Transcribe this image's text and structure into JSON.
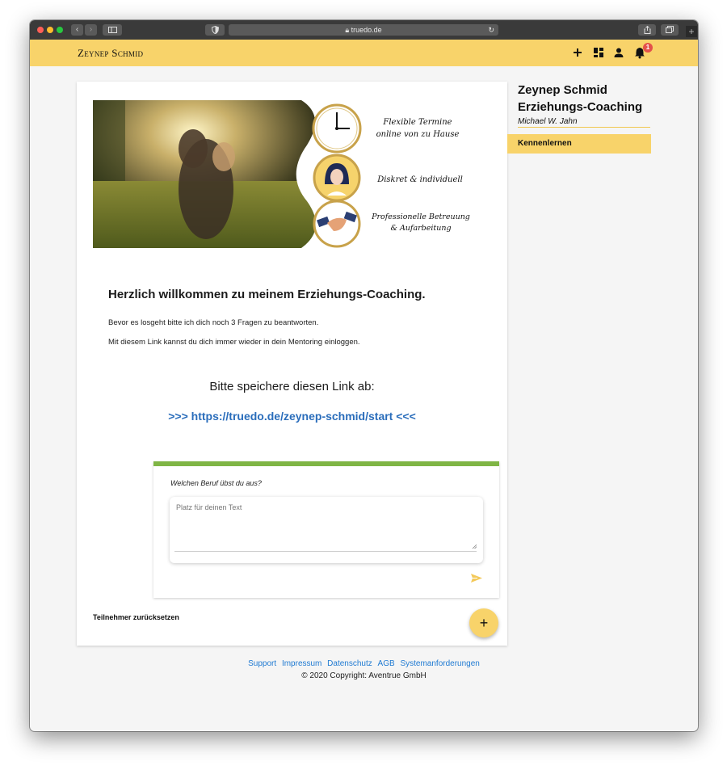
{
  "browser": {
    "url": "truedo.de"
  },
  "appbar": {
    "brand": "Zeynep Schmid",
    "notification_count": "1"
  },
  "main": {
    "banner_features": [
      {
        "line1": "Flexible Termine",
        "line2": "online von zu Hause"
      },
      {
        "line1": "Diskret & individuell",
        "line2": ""
      },
      {
        "line1": "Professionelle Betreuung",
        "line2": "& Aufarbeitung"
      }
    ],
    "welcome": "Herzlich willkommen zu meinem Erziehungs-Coaching.",
    "para1": "Bevor es losgeht bitte ich dich noch 3 Fragen zu beantworten.",
    "para2": "Mit diesem Link kannst du dich immer wieder in dein Mentoring einloggen.",
    "save_prompt": "Bitte speichere diesen Link ab:",
    "link_text": ">>> https://truedo.de/zeynep-schmid/start <<<",
    "question": {
      "label": "Welchen Beruf übst du aus?",
      "placeholder": "Platz für deinen Text"
    },
    "reset_label": "Teilnehmer zurücksetzen",
    "fab_label": "+"
  },
  "sidebar": {
    "title_line1": "Zeynep Schmid",
    "title_line2": "Erziehungs-Coaching",
    "author": "Michael W. Jahn",
    "items": [
      {
        "label": "Kennenlernen"
      }
    ]
  },
  "footer": {
    "links": [
      "Support",
      "Impressum",
      "Datenschutz",
      "AGB",
      "Systemanforderungen"
    ],
    "copyright": "© 2020 Copyright: Aventrue GmbH"
  },
  "colors": {
    "accent_yellow": "#f8d36a",
    "question_bar_green": "#7fb545",
    "link_blue": "#2a6dbb",
    "footer_link_blue": "#1f7ad2",
    "badge_red": "#e4514a"
  }
}
